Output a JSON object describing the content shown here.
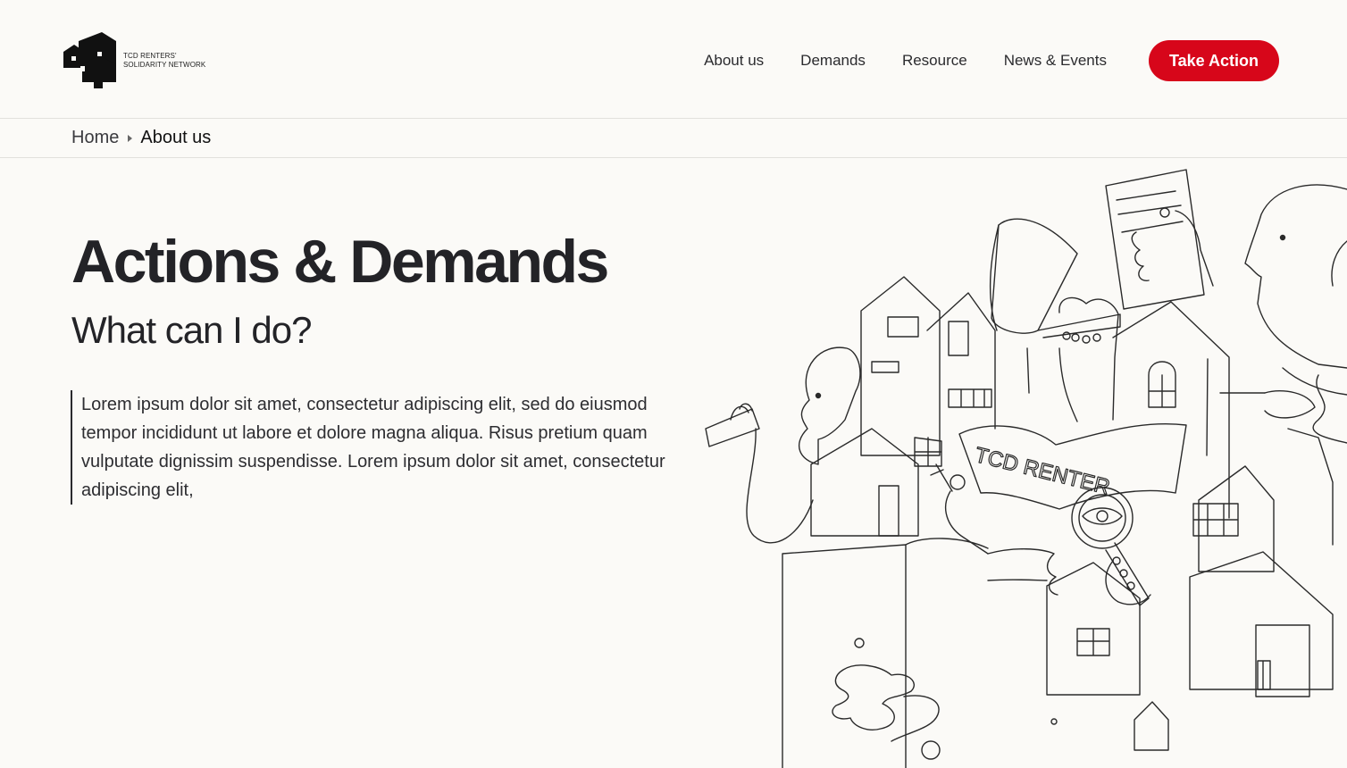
{
  "brand": {
    "name_line1": "TCD RENTERS'",
    "name_line2": "SOLIDARITY NETWORK"
  },
  "nav": {
    "items": [
      "About us",
      "Demands",
      "Resource",
      "News & Events"
    ],
    "cta_label": "Take Action"
  },
  "breadcrumb": {
    "home": "Home",
    "current": "About us"
  },
  "hero": {
    "title": "Actions & Demands",
    "subtitle": "What can I do?",
    "body": "Lorem ipsum dolor sit amet, consectetur adipiscing elit, sed do eiusmod tempor incididunt ut labore et dolore magna aliqua. Risus pretium quam vulputate dignissim suspendisse. Lorem ipsum dolor sit amet, consectetur adipiscing elit,"
  },
  "illustration": {
    "banner_text": "TCD RENTER"
  },
  "colors": {
    "accent": "#d7061a",
    "background": "#fbfaf7",
    "text": "#232327"
  }
}
